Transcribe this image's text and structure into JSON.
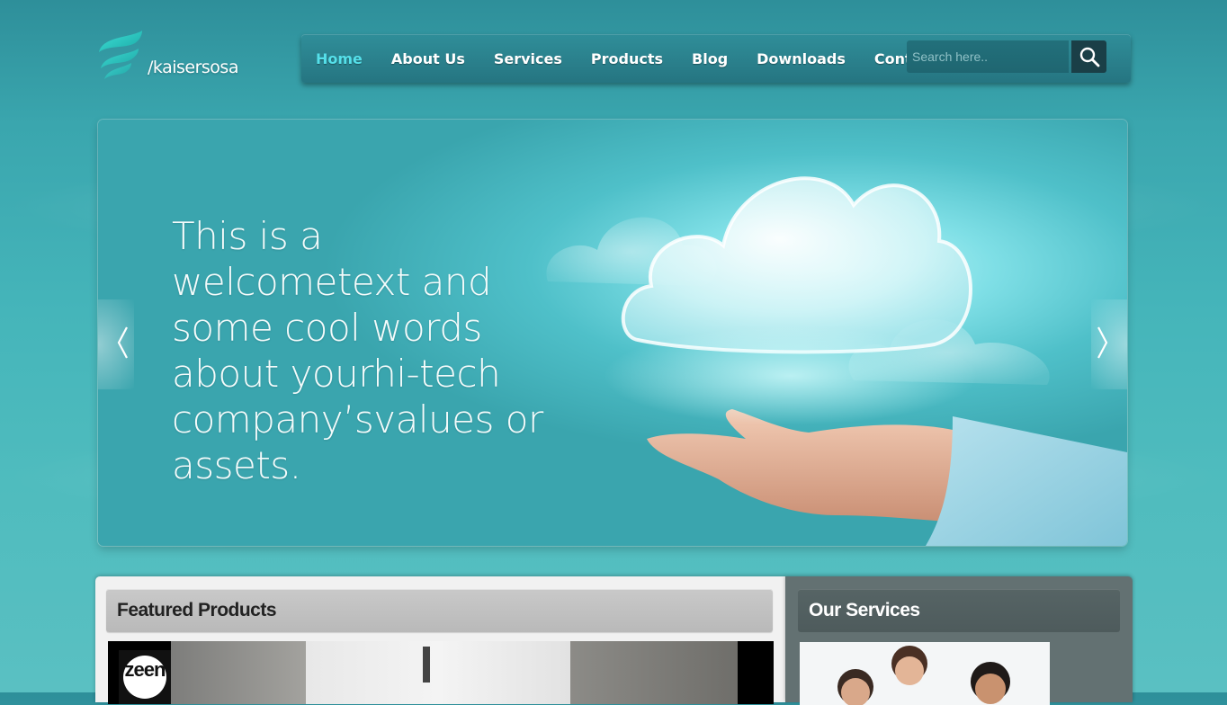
{
  "logo": {
    "text": "/kaisersosa"
  },
  "nav": {
    "items": [
      {
        "label": "Home",
        "active": true
      },
      {
        "label": "About Us"
      },
      {
        "label": "Services"
      },
      {
        "label": "Products"
      },
      {
        "label": "Blog"
      },
      {
        "label": "Downloads"
      },
      {
        "label": "Contact"
      }
    ],
    "search_placeholder": "Search here.."
  },
  "hero": {
    "text": "This is a welcometext and some cool words about yourhi-tech company’svalues or assets."
  },
  "featured": {
    "title": "Featured Products",
    "logo_text": "zeen"
  },
  "services": {
    "title": "Our Services"
  },
  "colors": {
    "accent": "#55e0ea",
    "nav_bg": "#2a7f8b",
    "services_bg": "#637172"
  }
}
